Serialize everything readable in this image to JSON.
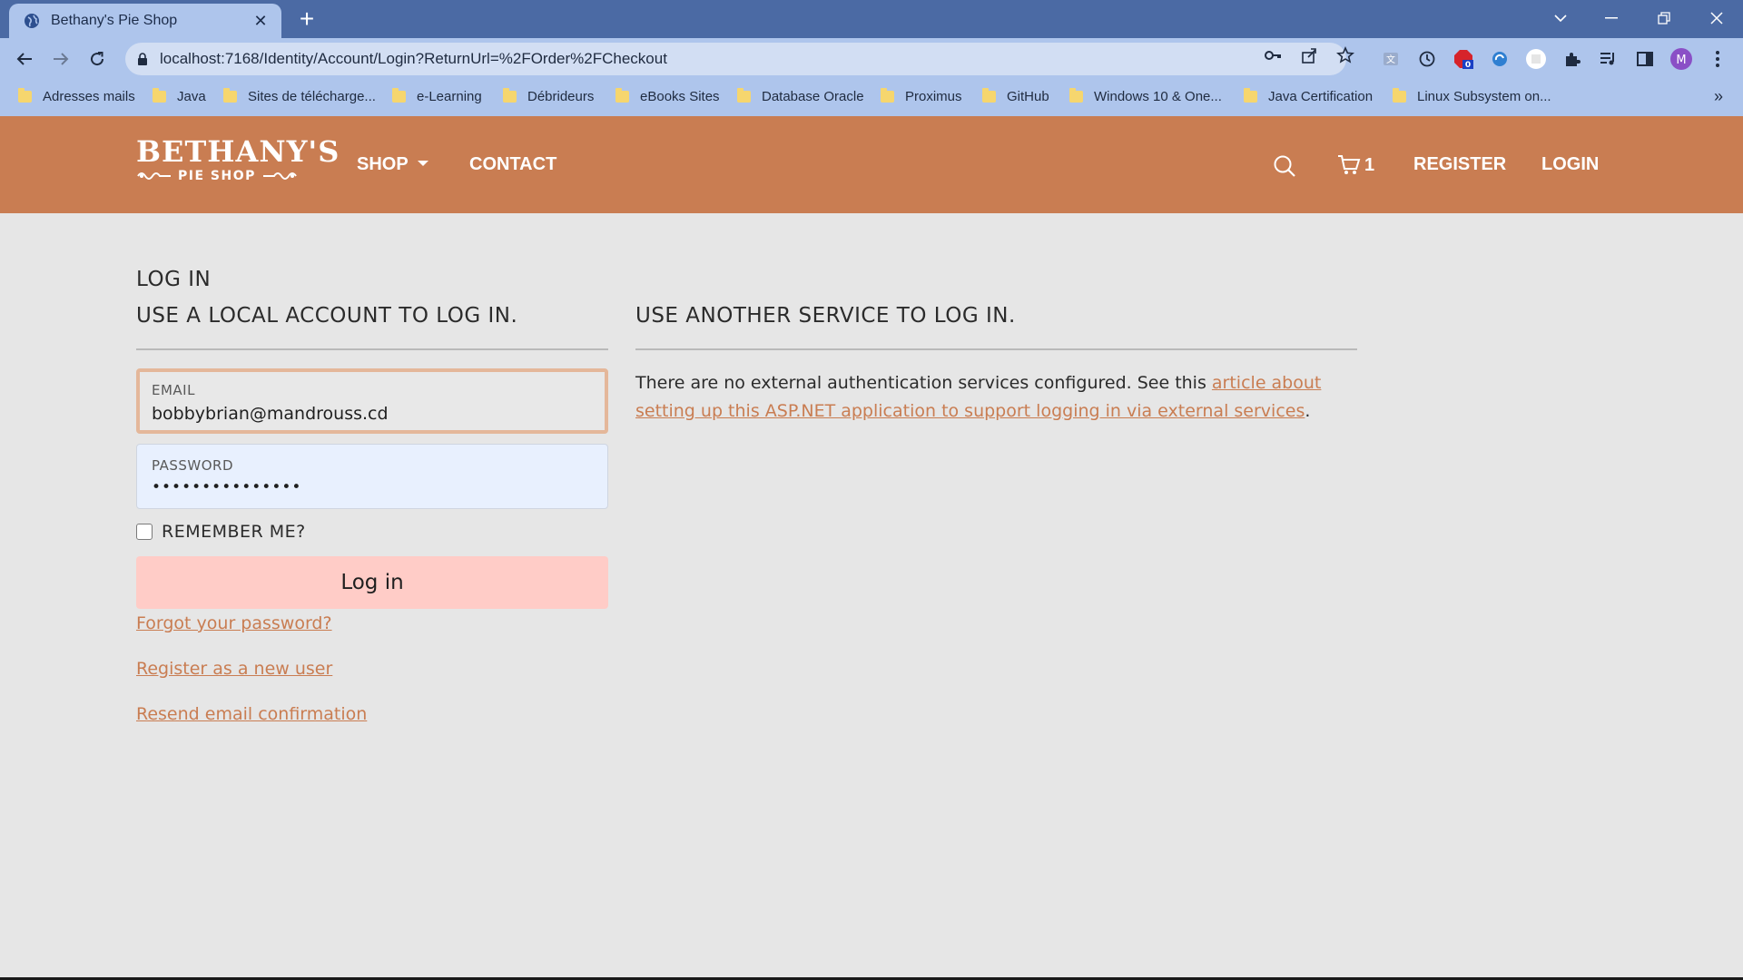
{
  "browser": {
    "tab_title": "Bethany's Pie Shop",
    "tab_close": "✕",
    "new_tab": "+",
    "url": "localhost:7168/Identity/Account/Login?ReturnUrl=%2FOrder%2FCheckout",
    "profile_initial": "M",
    "extension_badge": "0",
    "bookmarks": [
      "Adresses mails",
      "Java",
      "Sites de télécharge...",
      "e-Learning",
      "Débrideurs",
      "eBooks Sites",
      "Database Oracle",
      "Proximus",
      "GitHub",
      "Windows 10 & One...",
      "Java Certification",
      "Linux Subsystem on..."
    ],
    "bookmarks_more": "»"
  },
  "header": {
    "logo_top": "BETHANY'S",
    "logo_bottom": "PIE SHOP",
    "nav_shop": "SHOP",
    "nav_contact": "CONTACT",
    "cart_count": "1",
    "nav_register": "REGISTER",
    "nav_login": "LOGIN"
  },
  "page": {
    "title": "LOG IN",
    "local_heading": "USE A LOCAL ACCOUNT TO LOG IN.",
    "external_heading": "USE ANOTHER SERVICE TO LOG IN.",
    "email_label": "EMAIL",
    "email_value": "bobbybrian@mandrouss.cd",
    "password_label": "PASSWORD",
    "password_value": "•••••••••••••••",
    "remember_label": "REMEMBER ME?",
    "remember_checked": false,
    "login_button": "Log in",
    "forgot_link": "Forgot your password?",
    "register_link": "Register as a new user",
    "resend_link": "Resend email confirmation",
    "external_text": "There are no external authentication services configured. See this ",
    "external_link": "article about setting up this ASP.NET application to support logging in via external services",
    "external_end": "."
  },
  "colors": {
    "brand": "#c97d52",
    "tab_strip": "#4b6aa4",
    "toolbar": "#aec5ec",
    "login_button": "#ffccc7"
  }
}
